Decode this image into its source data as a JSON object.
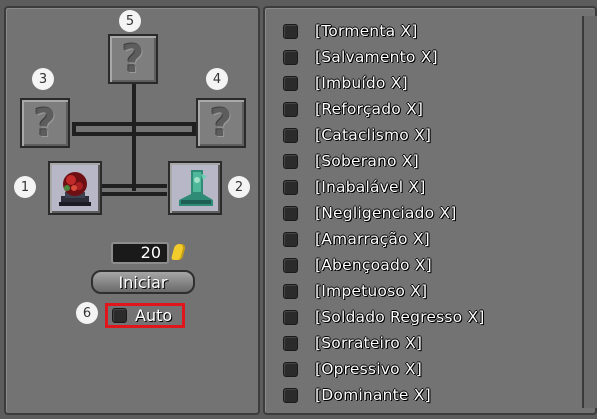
{
  "slots": [
    {
      "badge": "1",
      "icon": "dark-crystal-item-icon",
      "state": "filled"
    },
    {
      "badge": "2",
      "icon": "green-dragon-boot-item-icon",
      "state": "filled"
    },
    {
      "badge": "3",
      "icon": "mystery-bag-icon",
      "state": "empty"
    },
    {
      "badge": "4",
      "icon": "mystery-bag-icon",
      "state": "empty"
    },
    {
      "badge": "5",
      "icon": "mystery-bag-icon",
      "state": "empty"
    }
  ],
  "empty_slot_glyph": "?",
  "cost": {
    "value": "20",
    "currency_icon": "gold-coin-icon"
  },
  "start_button": {
    "label": "Iniciar"
  },
  "auto": {
    "badge": "6",
    "label": "Auto",
    "checked": false,
    "highlight_color": "#e0161c"
  },
  "imbuement_list": [
    "[Tormenta X]",
    "[Salvamento X]",
    "[Imbuído X]",
    "[Reforçado X]",
    "[Cataclismo X]",
    "[Soberano X]",
    "[Inabalável X]",
    "[Negligenciado X]",
    "[Amarração X]",
    "[Abençoado X]",
    "[Impetuoso X]",
    "[Soldado Regresso X]",
    "[Sorrateiro X]",
    "[Opressivo X]",
    "[Dominante X]"
  ]
}
